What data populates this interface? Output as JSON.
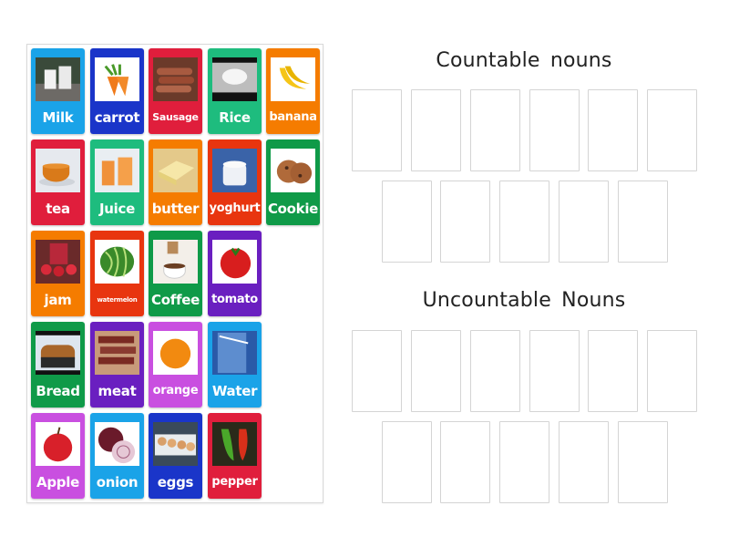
{
  "cards": [
    {
      "label": "Milk",
      "color": "#1aa3e8",
      "icon": "milk-glasses-image",
      "size": ""
    },
    {
      "label": "carrot",
      "color": "#1a35c9",
      "icon": "carrot-image",
      "size": ""
    },
    {
      "label": "Sausage",
      "color": "#e01e3c",
      "icon": "sausage-image",
      "size": "sm"
    },
    {
      "label": "Rice",
      "color": "#1ebc7e",
      "icon": "rice-bowl-image",
      "size": ""
    },
    {
      "label": "banana",
      "color": "#f57c00",
      "icon": "banana-image",
      "size": "sm2"
    },
    {
      "label": "tea",
      "color": "#e01e3c",
      "icon": "tea-cup-image",
      "size": ""
    },
    {
      "label": "Juice",
      "color": "#1ebc7e",
      "icon": "juice-glasses-image",
      "size": ""
    },
    {
      "label": "butter",
      "color": "#f57c00",
      "icon": "butter-image",
      "size": ""
    },
    {
      "label": "yoghurt",
      "color": "#e8350f",
      "icon": "yoghurt-image",
      "size": "sm2"
    },
    {
      "label": "Cookie",
      "color": "#0f9a48",
      "icon": "cookie-image",
      "size": ""
    },
    {
      "label": "jam",
      "color": "#f57c00",
      "icon": "jam-strawberries-image",
      "size": ""
    },
    {
      "label": "watermelon",
      "color": "#e8350f",
      "icon": "watermelon-image",
      "size": "xs"
    },
    {
      "label": "Coffee",
      "color": "#0f9a48",
      "icon": "coffee-cup-image",
      "size": ""
    },
    {
      "label": "tomato",
      "color": "#6a1fc0",
      "icon": "tomato-image",
      "size": "sm2"
    },
    {
      "label": "Bread",
      "color": "#0f9a48",
      "icon": "bread-loaf-image",
      "size": ""
    },
    {
      "label": "meat",
      "color": "#6a1fc0",
      "icon": "meat-image",
      "size": ""
    },
    {
      "label": "orange",
      "color": "#c94fe0",
      "icon": "orange-fruit-image",
      "size": "sm2"
    },
    {
      "label": "Water",
      "color": "#1aa3e8",
      "icon": "water-glass-image",
      "size": ""
    },
    {
      "label": "Apple",
      "color": "#c94fe0",
      "icon": "apple-image",
      "size": ""
    },
    {
      "label": "onion",
      "color": "#1aa3e8",
      "icon": "onion-image",
      "size": ""
    },
    {
      "label": "eggs",
      "color": "#1a35c9",
      "icon": "eggs-image",
      "size": ""
    },
    {
      "label": "pepper",
      "color": "#e01e3c",
      "icon": "pepper-image",
      "size": "sm2"
    }
  ],
  "groups": [
    {
      "title": "Countable  nouns",
      "slot_count": 11
    },
    {
      "title": "Uncountable  Nouns",
      "slot_count": 11
    }
  ]
}
